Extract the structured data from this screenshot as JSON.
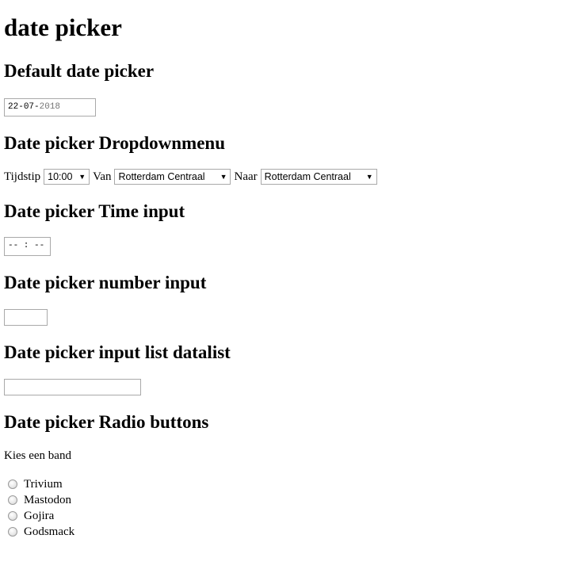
{
  "title": "date picker",
  "sections": {
    "default": {
      "heading": "Default date picker",
      "date": {
        "day": "22",
        "month": "07",
        "year": "2018",
        "sep1": "-",
        "sep2": "-"
      }
    },
    "dropdown": {
      "heading": "Date picker Dropdownmenu",
      "tijdstip_label": "Tijdstip",
      "tijdstip_value": "10:00",
      "van_label": "Van",
      "van_value": "Rotterdam Centraal",
      "naar_label": "Naar",
      "naar_value": "Rotterdam Centraal"
    },
    "time": {
      "heading": "Date picker Time input",
      "placeholder": "-- : --"
    },
    "number": {
      "heading": "Date picker number input",
      "value": ""
    },
    "datalist": {
      "heading": "Date picker input list datalist",
      "value": ""
    },
    "radio": {
      "heading": "Date picker Radio buttons",
      "prompt": "Kies een band",
      "options": [
        "Trivium",
        "Mastodon",
        "Gojira",
        "Godsmack"
      ]
    }
  },
  "icons": {
    "select_arrow": "dropdown-arrow-icon",
    "radio": "radio-button-icon"
  }
}
